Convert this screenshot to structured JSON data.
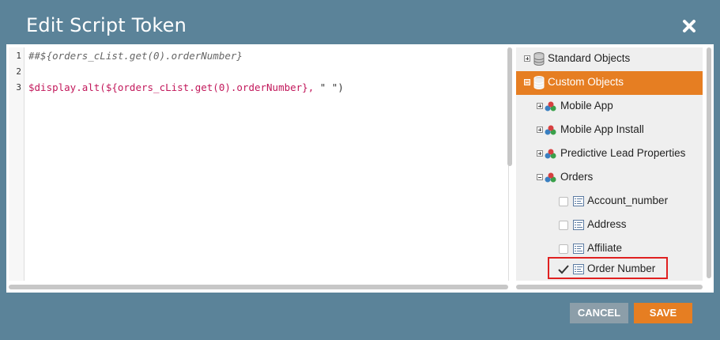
{
  "modal": {
    "title": "Edit Script Token",
    "close_icon": "close-icon"
  },
  "editor": {
    "line_numbers": [
      "1",
      "2",
      "3"
    ],
    "lines": [
      "##${orders_cList.get(0).orderNumber}",
      "",
      "$display.alt(${orders_cList.get(0).orderNumber}, \" \")"
    ],
    "line3_parts": {
      "a": "$display.alt(${orders_cList.get(0).orderNumber},",
      "b": " \" \")"
    }
  },
  "tree": {
    "items": [
      {
        "label": "Standard Objects",
        "icon": "database-icon",
        "expander": "plus"
      },
      {
        "label": "Custom Objects",
        "icon": "database-icon",
        "expander": "minus",
        "selected": true
      },
      {
        "label": "Mobile App",
        "icon": "object-icon",
        "expander": "plus"
      },
      {
        "label": "Mobile App Install",
        "icon": "object-icon",
        "expander": "plus"
      },
      {
        "label": "Predictive Lead Properties",
        "icon": "object-icon",
        "expander": "plus"
      },
      {
        "label": "Orders",
        "icon": "object-icon",
        "expander": "minus"
      },
      {
        "label": "Account_number",
        "icon": "field-icon",
        "checked": false
      },
      {
        "label": "Address",
        "icon": "field-icon",
        "checked": false
      },
      {
        "label": "Affiliate",
        "icon": "field-icon",
        "checked": false
      },
      {
        "label": "Order Number",
        "icon": "field-icon",
        "checked": true
      }
    ]
  },
  "footer": {
    "cancel_label": "CANCEL",
    "save_label": "SAVE"
  },
  "colors": {
    "header": "#5b8399",
    "accent": "#e67e22",
    "cancel": "#8c9ea9",
    "highlight": "#e02020",
    "code_pink": "#c2185b"
  }
}
